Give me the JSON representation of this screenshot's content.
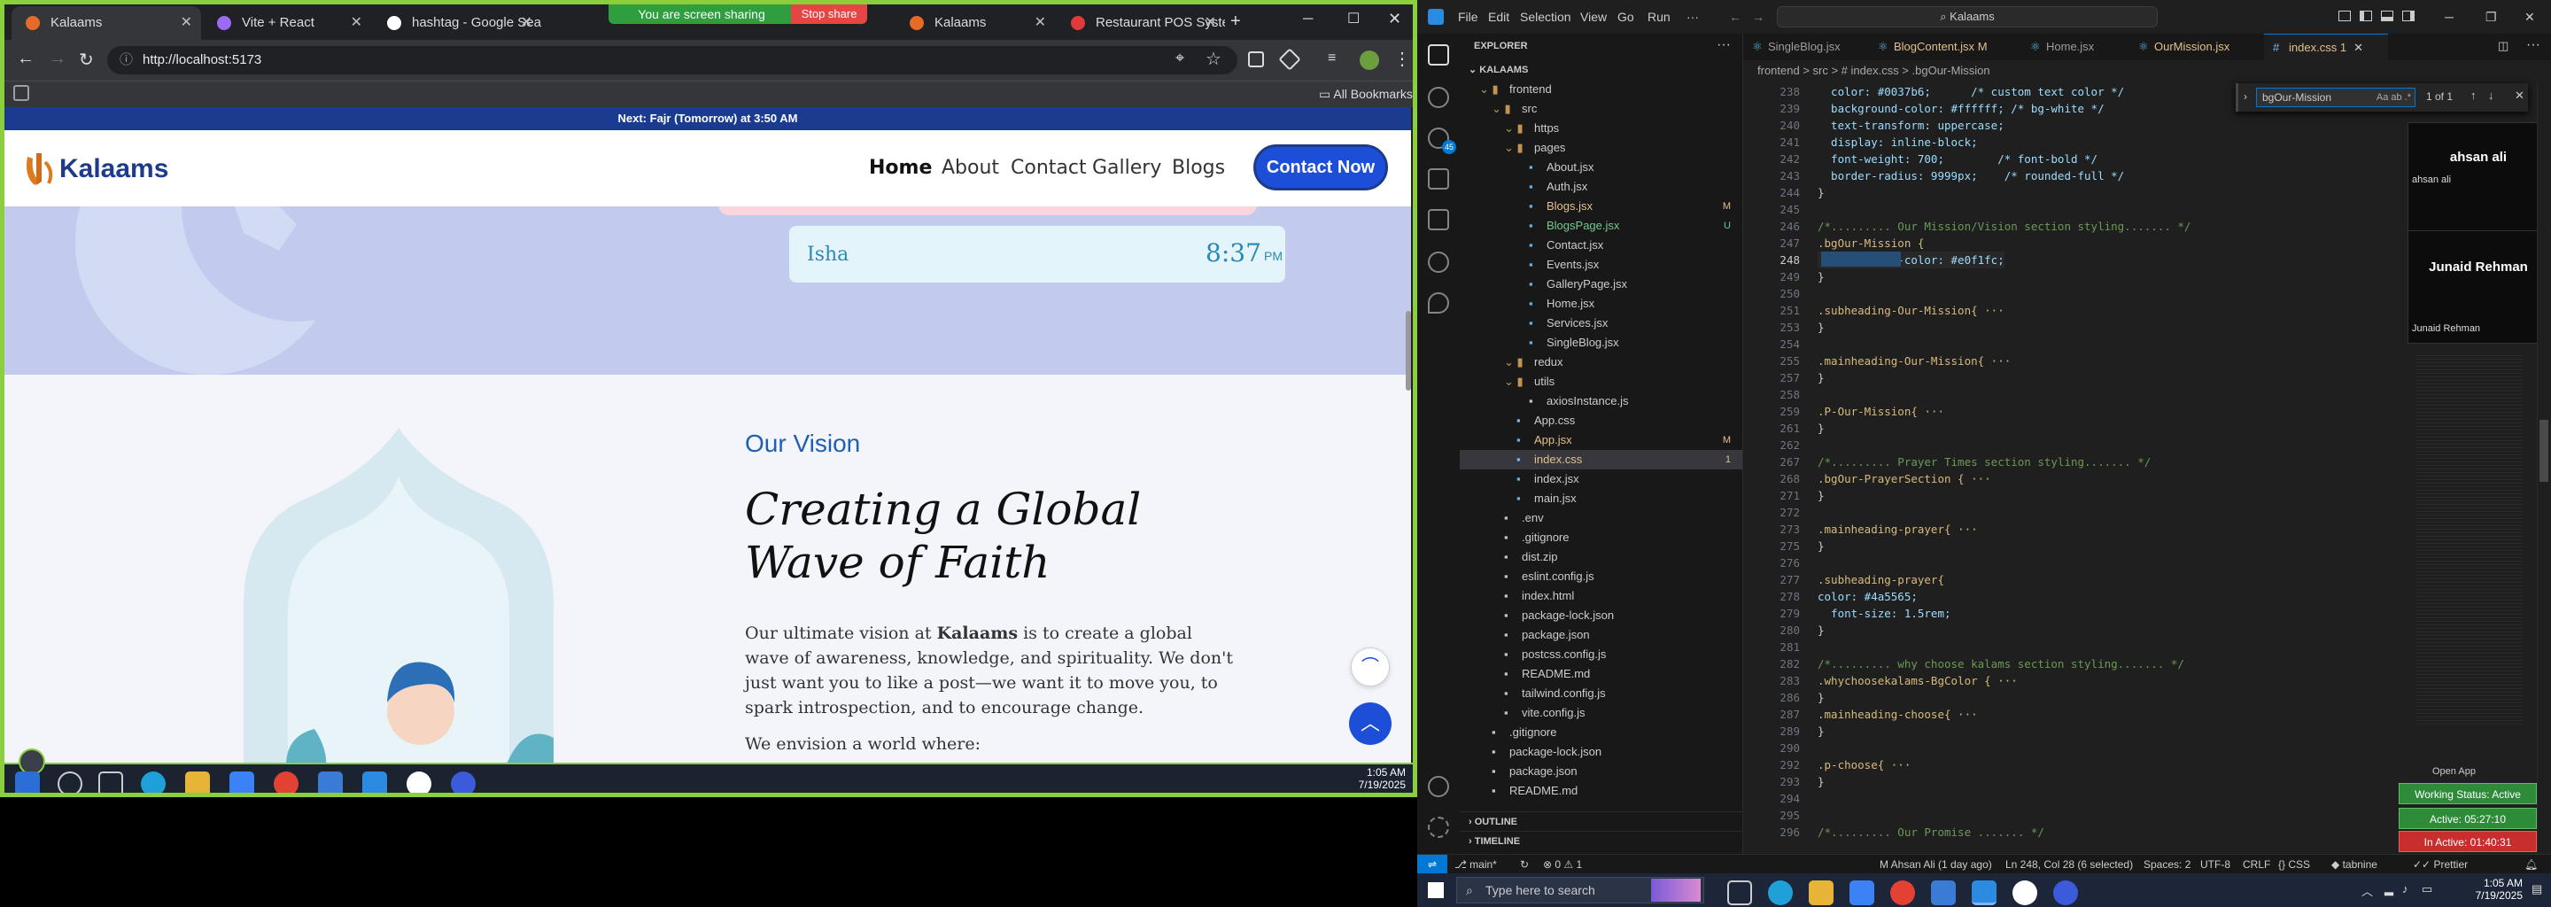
{
  "browser": {
    "tabs": [
      {
        "label": "Kalaams",
        "active": true
      },
      {
        "label": "Vite + React",
        "active": false
      },
      {
        "label": "hashtag - Google Sea",
        "active": false
      },
      {
        "label": "Restaurant POS Syste",
        "active": false
      }
    ],
    "screen_share_text": "You are screen sharing",
    "stop_share_label": "Stop share",
    "tab_kalaams2": "Kalaams",
    "url": "http://localhost:5173",
    "bookmarks_label": "All Bookmarks"
  },
  "site": {
    "prayer_bar_prefix": "Next: ",
    "prayer_bar_name": "Fajr (Tomorrow)",
    "prayer_bar_suffix": " at 3:50 AM",
    "logo": "Kalaams",
    "nav": [
      "Home",
      "About",
      "Contact",
      "Gallery",
      "Blogs"
    ],
    "cta": "Contact Now",
    "prayer_card": {
      "name": "Isha",
      "time": "8:37",
      "ampm": "PM"
    },
    "vision": {
      "eyebrow": "Our Vision",
      "heading_line1": "Creating a Global",
      "heading_line2": "Wave of Faith",
      "para_before": "Our ultimate vision at ",
      "para_bold": "Kalaams",
      "para_after": " is to create a global wave of awareness, knowledge, and spirituality. We don't just want you to like a post—we want it to move you, to spark introspection, and to encourage change.",
      "para2": "We envision a world where:"
    }
  },
  "left_taskbar": {
    "time": "1:05 AM",
    "date": "7/19/2025"
  },
  "vscode": {
    "search_title": "Kalaams",
    "menus": [
      "File",
      "Edit",
      "Selection",
      "View",
      "Go",
      "Run"
    ],
    "explorer_title": "EXPLORER",
    "root": "KALAAMS",
    "tree": [
      {
        "label": "frontend",
        "depth": 1,
        "folder": true,
        "badge": ""
      },
      {
        "label": "src",
        "depth": 2,
        "folder": true,
        "badge": ""
      },
      {
        "label": "https",
        "depth": 3,
        "folder": true,
        "badge": ""
      },
      {
        "label": "pages",
        "depth": 3,
        "folder": true,
        "badge": ""
      },
      {
        "label": "About.jsx",
        "depth": 4,
        "folder": false,
        "badge": ""
      },
      {
        "label": "Auth.jsx",
        "depth": 4,
        "folder": false,
        "badge": ""
      },
      {
        "label": "Blogs.jsx",
        "depth": 4,
        "folder": false,
        "badge": "M"
      },
      {
        "label": "BlogsPage.jsx",
        "depth": 4,
        "folder": false,
        "badge": "U"
      },
      {
        "label": "Contact.jsx",
        "depth": 4,
        "folder": false,
        "badge": ""
      },
      {
        "label": "Events.jsx",
        "depth": 4,
        "folder": false,
        "badge": ""
      },
      {
        "label": "GalleryPage.jsx",
        "depth": 4,
        "folder": false,
        "badge": ""
      },
      {
        "label": "Home.jsx",
        "depth": 4,
        "folder": false,
        "badge": ""
      },
      {
        "label": "Services.jsx",
        "depth": 4,
        "folder": false,
        "badge": ""
      },
      {
        "label": "SingleBlog.jsx",
        "depth": 4,
        "folder": false,
        "badge": ""
      },
      {
        "label": "redux",
        "depth": 3,
        "folder": true,
        "badge": ""
      },
      {
        "label": "utils",
        "depth": 3,
        "folder": true,
        "badge": ""
      },
      {
        "label": "axiosInstance.js",
        "depth": 4,
        "folder": false,
        "badge": ""
      },
      {
        "label": "App.css",
        "depth": 3,
        "folder": false,
        "badge": ""
      },
      {
        "label": "App.jsx",
        "depth": 3,
        "folder": false,
        "badge": "M"
      },
      {
        "label": "index.css",
        "depth": 3,
        "folder": false,
        "badge": "1"
      },
      {
        "label": "index.jsx",
        "depth": 3,
        "folder": false,
        "badge": ""
      },
      {
        "label": "main.jsx",
        "depth": 3,
        "folder": false,
        "badge": ""
      },
      {
        "label": ".env",
        "depth": 2,
        "folder": false,
        "badge": ""
      },
      {
        "label": ".gitignore",
        "depth": 2,
        "folder": false,
        "badge": ""
      },
      {
        "label": "dist.zip",
        "depth": 2,
        "folder": false,
        "badge": ""
      },
      {
        "label": "eslint.config.js",
        "depth": 2,
        "folder": false,
        "badge": ""
      },
      {
        "label": "index.html",
        "depth": 2,
        "folder": false,
        "badge": ""
      },
      {
        "label": "package-lock.json",
        "depth": 2,
        "folder": false,
        "badge": ""
      },
      {
        "label": "package.json",
        "depth": 2,
        "folder": false,
        "badge": ""
      },
      {
        "label": "postcss.config.js",
        "depth": 2,
        "folder": false,
        "badge": ""
      },
      {
        "label": "README.md",
        "depth": 2,
        "folder": false,
        "badge": ""
      },
      {
        "label": "tailwind.config.js",
        "depth": 2,
        "folder": false,
        "badge": ""
      },
      {
        "label": "vite.config.js",
        "depth": 2,
        "folder": false,
        "badge": ""
      },
      {
        "label": ".gitignore",
        "depth": 1,
        "folder": false,
        "badge": ""
      },
      {
        "label": "package-lock.json",
        "depth": 1,
        "folder": false,
        "badge": ""
      },
      {
        "label": "package.json",
        "depth": 1,
        "folder": false,
        "badge": ""
      },
      {
        "label": "README.md",
        "depth": 1,
        "folder": false,
        "badge": ""
      }
    ],
    "outline": "OUTLINE",
    "timeline": "TIMELINE",
    "editor_tabs": [
      {
        "label": "SingleBlog.jsx",
        "active": false
      },
      {
        "label": "BlogContent.jsx",
        "suffix": "M",
        "active": false
      },
      {
        "label": "Home.jsx",
        "active": false
      },
      {
        "label": "OurMission.jsx",
        "active": false
      },
      {
        "label": "index.css",
        "suffix": "1",
        "active": true
      }
    ],
    "breadcrumb": "frontend > src > # index.css > .bgOur-Mission",
    "find": {
      "query": "bgOur-Mission",
      "result": "1 of 1"
    },
    "participants": [
      "ahsan ali",
      "Junaid Rehman"
    ],
    "code": [
      {
        "n": "238",
        "t": "  color: #0037b6;      /* custom text color */"
      },
      {
        "n": "239",
        "t": "  background-color: #ffffff; /* bg-white */"
      },
      {
        "n": "240",
        "t": "  text-transform: uppercase;"
      },
      {
        "n": "241",
        "t": "  display: inline-block;"
      },
      {
        "n": "242",
        "t": "  font-weight: 700;        /* font-bold */"
      },
      {
        "n": "243",
        "t": "  border-radius: 9999px;    /* rounded-full */"
      },
      {
        "n": "244",
        "t": "}"
      },
      {
        "n": "245",
        "t": ""
      },
      {
        "n": "246",
        "t": "/*......... Our Mission/Vision section styling....... */"
      },
      {
        "n": "247",
        "t": ".bgOur-Mission {"
      },
      {
        "n": "248",
        "t": "  background-color: #e0f1fc;"
      },
      {
        "n": "249",
        "t": "}"
      },
      {
        "n": "250",
        "t": ""
      },
      {
        "n": "251",
        "t": ".subheading-Our-Mission{ ···"
      },
      {
        "n": "253",
        "t": "}"
      },
      {
        "n": "254",
        "t": ""
      },
      {
        "n": "255",
        "t": ".mainheading-Our-Mission{ ···"
      },
      {
        "n": "257",
        "t": "}"
      },
      {
        "n": "258",
        "t": ""
      },
      {
        "n": "259",
        "t": ".P-Our-Mission{ ···"
      },
      {
        "n": "261",
        "t": "}"
      },
      {
        "n": "262",
        "t": ""
      },
      {
        "n": "267",
        "t": "/*......... Prayer Times section styling....... */"
      },
      {
        "n": "268",
        "t": ".bgOur-PrayerSection { ···"
      },
      {
        "n": "271",
        "t": "}"
      },
      {
        "n": "272",
        "t": ""
      },
      {
        "n": "273",
        "t": ".mainheading-prayer{ ···"
      },
      {
        "n": "275",
        "t": "}"
      },
      {
        "n": "276",
        "t": ""
      },
      {
        "n": "277",
        "t": ".subheading-prayer{"
      },
      {
        "n": "278",
        "t": "color: #4a5565;"
      },
      {
        "n": "279",
        "t": "  font-size: 1.5rem;"
      },
      {
        "n": "280",
        "t": "}"
      },
      {
        "n": "281",
        "t": ""
      },
      {
        "n": "282",
        "t": "/*......... why choose kalams section styling....... */"
      },
      {
        "n": "283",
        "t": ".whychoosekalams-BgColor { ···"
      },
      {
        "n": "286",
        "t": "}"
      },
      {
        "n": "287",
        "t": ".mainheading-choose{ ···"
      },
      {
        "n": "289",
        "t": "}"
      },
      {
        "n": "290",
        "t": ""
      },
      {
        "n": "292",
        "t": ".p-choose{ ···"
      },
      {
        "n": "293",
        "t": "}"
      },
      {
        "n": "294",
        "t": ""
      },
      {
        "n": "295",
        "t": ""
      },
      {
        "n": "296",
        "t": "/*......... Our Promise ....... */"
      }
    ],
    "open_app": "Open App",
    "working_status": "Working Status: Active",
    "active_time": "Active: 05:27:10",
    "inactive_time": "In Active: 01:40:31",
    "status": {
      "branch": "main*",
      "errors": "0",
      "warnings": "1",
      "git": "M Ahsan Ali (1 day ago)",
      "position": "Ln 248, Col 28 (6 selected)",
      "spaces": "Spaces: 2",
      "encoding": "UTF-8",
      "eol": "CRLF",
      "lang": "CSS",
      "tabnine": "tabnine",
      "prettier": "Prettier"
    },
    "search_placeholder": "Type here to search",
    "time": "1:05 AM",
    "date": "7/19/2025"
  }
}
